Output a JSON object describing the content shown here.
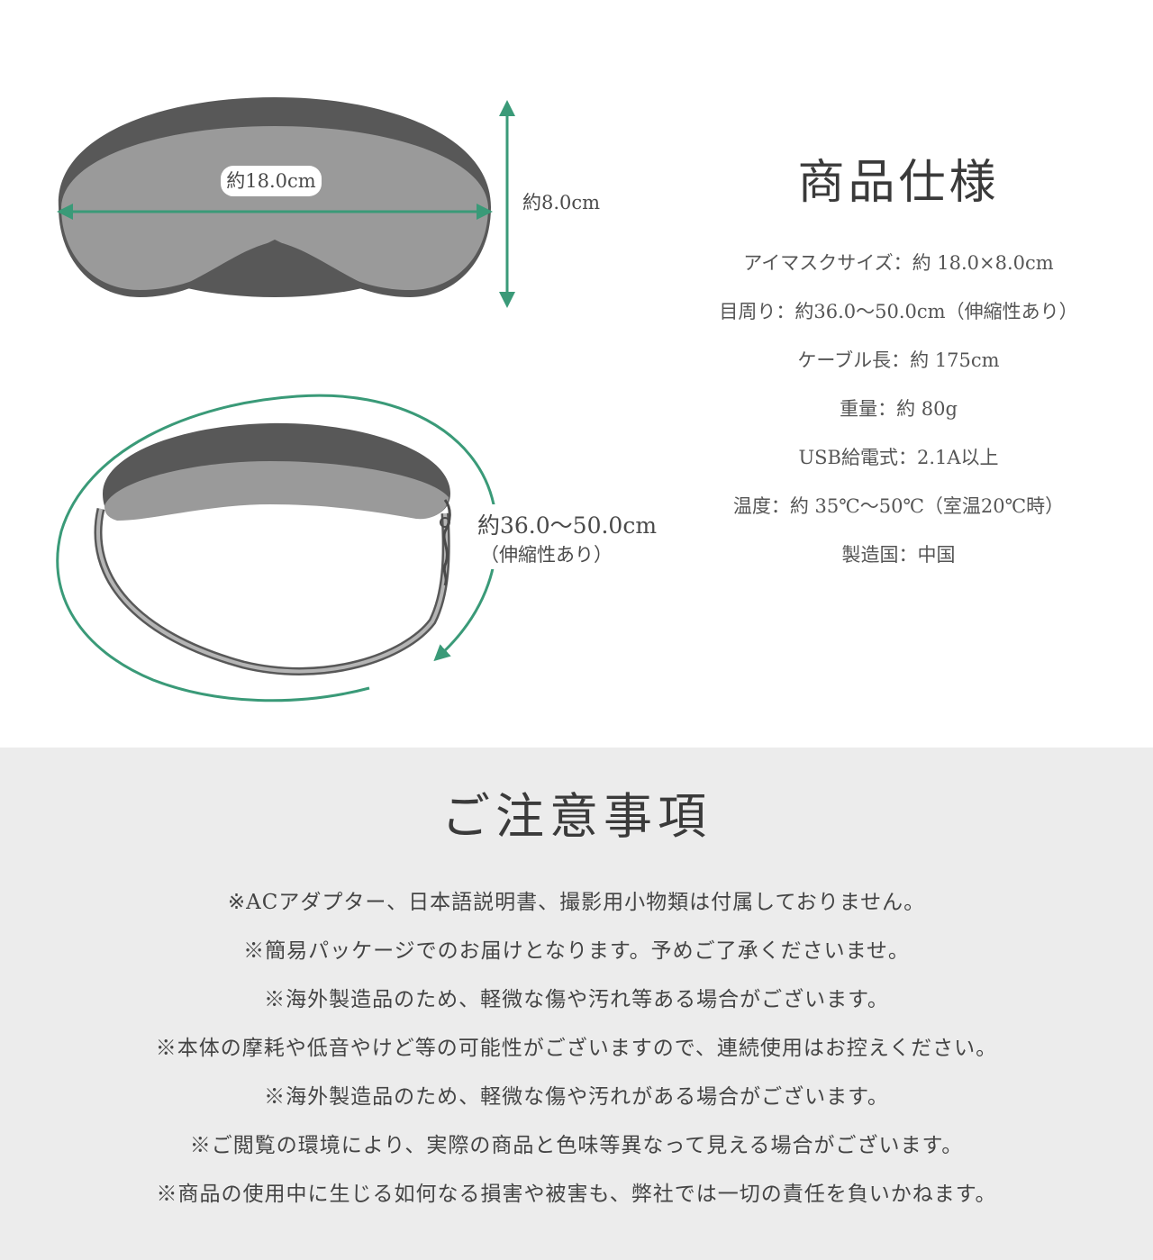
{
  "diagram": {
    "width_label": "約18.0cm",
    "height_label": "約8.0cm",
    "circumference_label": "約36.0〜50.0cm",
    "circumference_note": "（伸縮性あり）",
    "accent_color": "#3a9a78",
    "mask_light_color": "#9a9a9a",
    "mask_dark_color": "#585858"
  },
  "spec": {
    "title": "商品仕様",
    "items": [
      "アイマスクサイズ：約 18.0×8.0cm",
      "目周り：約36.0〜50.0cm（伸縮性あり）",
      "ケーブル長：約 175cm",
      "重量：約 80g",
      "USB給電式：2.1A以上",
      "温度：約 35℃〜50℃（室温20℃時）",
      "製造国：中国"
    ]
  },
  "notice": {
    "title": "ご注意事項",
    "items": [
      "※ACアダプター、日本語説明書、撮影用小物類は付属しておりません。",
      "※簡易パッケージでのお届けとなります。予めご了承くださいませ。",
      "※海外製造品のため、軽微な傷や汚れ等ある場合がございます。",
      "※本体の摩耗や低音やけど等の可能性がございますので、連続使用はお控えください。",
      "※海外製造品のため、軽微な傷や汚れがある場合がございます。",
      "※ご閲覧の環境により、実際の商品と色味等異なって見える場合がございます。",
      "※商品の使用中に生じる如何なる損害や被害も、弊社では一切の責任を負いかねます。"
    ]
  }
}
